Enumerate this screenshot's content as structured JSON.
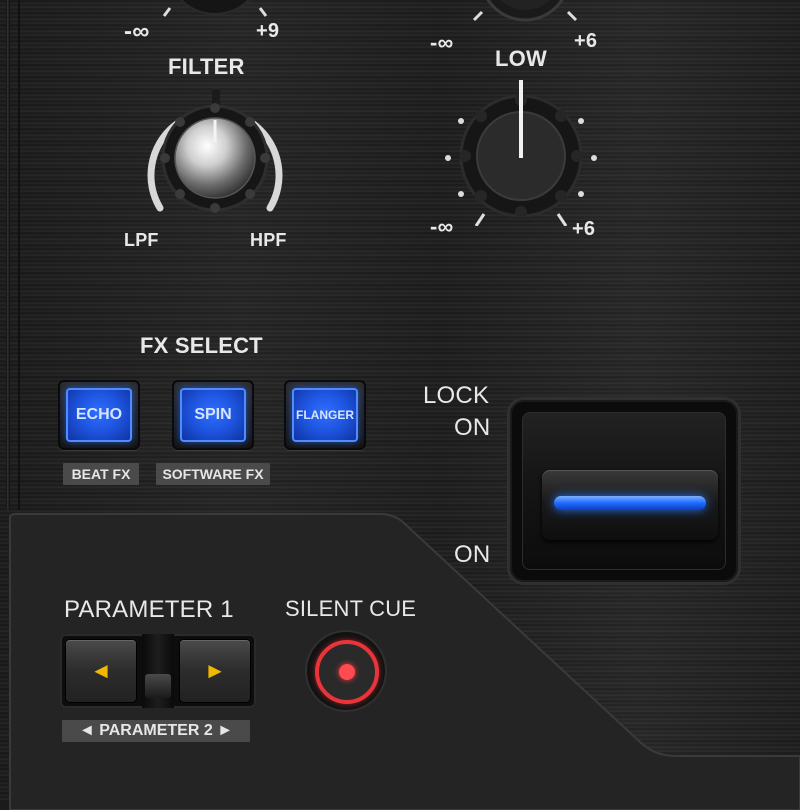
{
  "top_knob": {
    "min_label": "-∞",
    "max_label": "+9"
  },
  "mid_eq_knob": {
    "min_label": "-∞",
    "max_label": "+6",
    "label": "LOW"
  },
  "low_eq_knob": {
    "min_label": "-∞",
    "max_label": "+6"
  },
  "filter": {
    "label": "FILTER",
    "left_label": "LPF",
    "right_label": "HPF"
  },
  "fx_select": {
    "label": "FX SELECT",
    "buttons": [
      {
        "label": "ECHO"
      },
      {
        "label": "SPIN"
      },
      {
        "label": "FLANGER"
      }
    ],
    "groups": {
      "beat_fx": "BEAT FX",
      "software_fx": "SOFTWARE FX"
    }
  },
  "lock": {
    "top_label_1": "LOCK",
    "top_label_2": "ON",
    "bottom_label": "ON"
  },
  "parameter": {
    "label": "PARAMETER 1",
    "sub_label": "◄ PARAMETER 2 ►",
    "left": "◄",
    "right": "►"
  },
  "silent_cue": {
    "label": "SILENT CUE"
  },
  "colors": {
    "fx_blue": "#1e55e0",
    "lock_blue": "#1e6bff",
    "cue_red": "#e9343a",
    "arrow_yellow": "#f0b800"
  }
}
